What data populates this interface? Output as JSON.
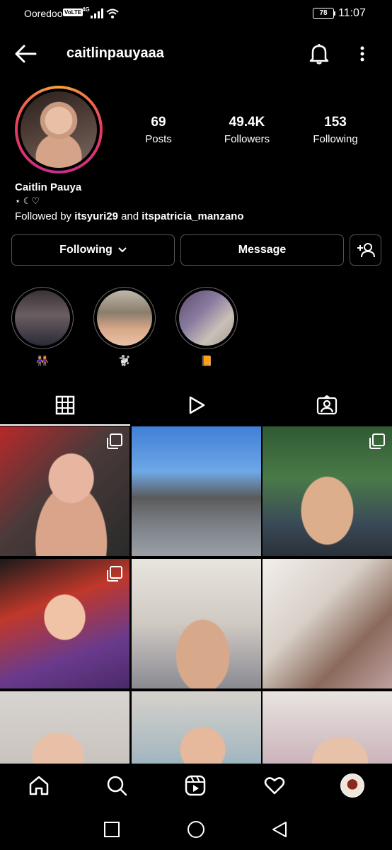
{
  "status_bar": {
    "carrier": "Ooredoo",
    "volte": "VoLTE",
    "network": "4G",
    "battery": "78",
    "time": "11:07"
  },
  "header": {
    "username": "caitlinpauyaaa",
    "icons": [
      "back-arrow-icon",
      "bell-icon",
      "more-vertical-icon"
    ]
  },
  "profile": {
    "stats": [
      {
        "value": "69",
        "label": "Posts"
      },
      {
        "value": "49.4K",
        "label": "Followers"
      },
      {
        "value": "153",
        "label": "Following"
      }
    ],
    "full_name": "Caitlin Pauya",
    "bio": "⋆ ☾♡",
    "followed_by_prefix": "Followed by ",
    "followed_by_user1": "itsyuri29",
    "followed_by_join": " and ",
    "followed_by_user2": "itspatricia_manzano"
  },
  "actions": {
    "following_label": "Following",
    "message_label": "Message"
  },
  "highlights": [
    {
      "label": "👭"
    },
    {
      "label": "🐩"
    },
    {
      "label": "📙"
    }
  ],
  "tabs": [
    "grid-icon",
    "reels-icon",
    "tagged-icon"
  ],
  "colors": {
    "background": "#000000",
    "text": "#ffffff",
    "button_border": "#555555",
    "story_ring_start": "#f9a33a",
    "story_ring_end": "#c22d8d"
  }
}
